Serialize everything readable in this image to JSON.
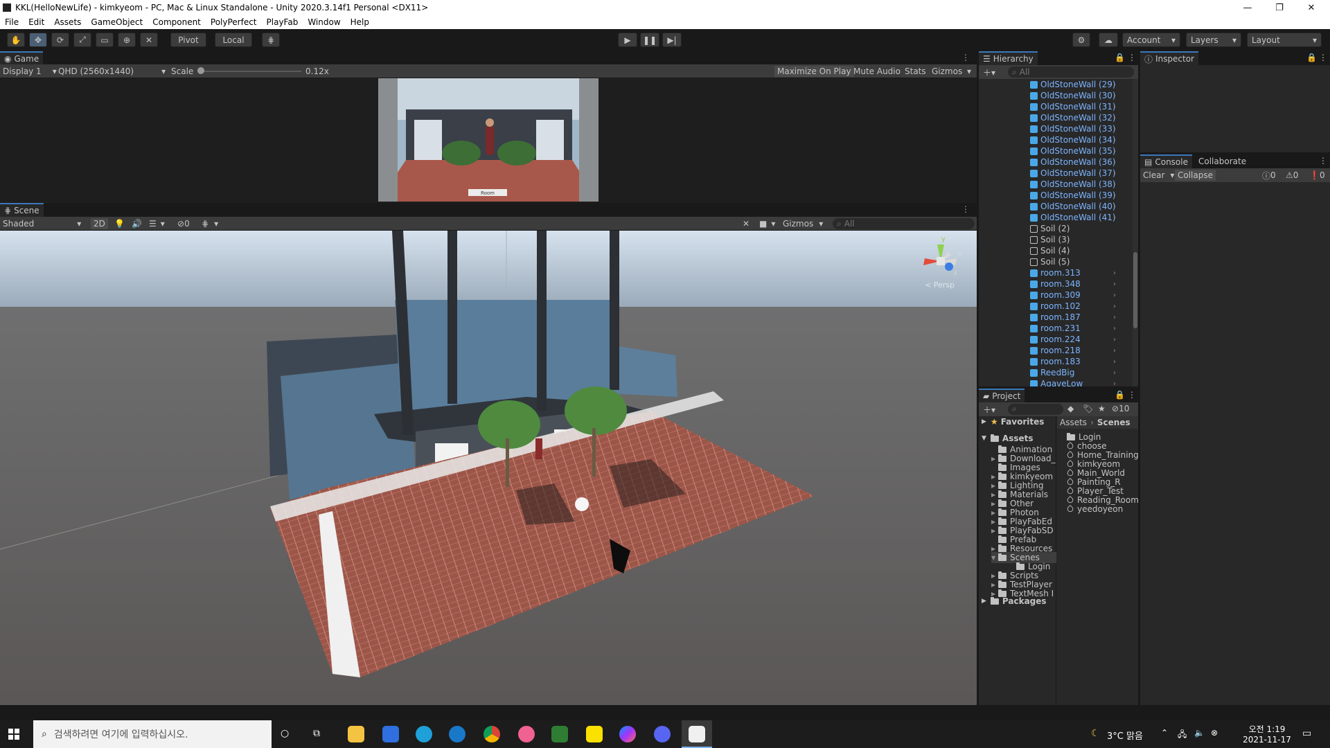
{
  "window": {
    "title": "KKL(HelloNewLife) - kimkyeom - PC, Mac & Linux Standalone - Unity 2020.3.14f1 Personal <DX11>",
    "controls": {
      "minimize": "—",
      "maximize": "❐",
      "close": "✕"
    }
  },
  "menu": [
    "File",
    "Edit",
    "Assets",
    "GameObject",
    "Component",
    "PolyPerfect",
    "PlayFab",
    "Window",
    "Help"
  ],
  "toolbar": {
    "pivot": "Pivot",
    "local": "Local",
    "account": "Account",
    "layers": "Layers",
    "layout": "Layout"
  },
  "game": {
    "tab": "Game",
    "display": "Display 1",
    "resolution": "QHD (2560x1440)",
    "scale_label": "Scale",
    "scale_value": "0.12x",
    "maximize": "Maximize On Play",
    "mute": "Mute Audio",
    "stats": "Stats",
    "gizmos": "Gizmos",
    "button_text": "Room"
  },
  "scene": {
    "tab": "Scene",
    "shading": "Shaded",
    "mode2d": "2D",
    "hidden_count": "0",
    "gizmos": "Gizmos",
    "search_placeholder": "All",
    "persp": "< Persp",
    "axis_y": "y",
    "axis_x": "x",
    "axis_z": "z"
  },
  "hierarchy": {
    "tab": "Hierarchy",
    "search_placeholder": "All",
    "items": [
      {
        "name": "OldStoneWall (29)",
        "prefab": true
      },
      {
        "name": "OldStoneWall (30)",
        "prefab": true
      },
      {
        "name": "OldStoneWall (31)",
        "prefab": true
      },
      {
        "name": "OldStoneWall (32)",
        "prefab": true
      },
      {
        "name": "OldStoneWall (33)",
        "prefab": true
      },
      {
        "name": "OldStoneWall (34)",
        "prefab": true
      },
      {
        "name": "OldStoneWall (35)",
        "prefab": true
      },
      {
        "name": "OldStoneWall (36)",
        "prefab": true
      },
      {
        "name": "OldStoneWall (37)",
        "prefab": true
      },
      {
        "name": "OldStoneWall (38)",
        "prefab": true
      },
      {
        "name": "OldStoneWall (39)",
        "prefab": true
      },
      {
        "name": "OldStoneWall (40)",
        "prefab": true
      },
      {
        "name": "OldStoneWall (41)",
        "prefab": true
      },
      {
        "name": "Soil (2)",
        "prefab": false
      },
      {
        "name": "Soil (3)",
        "prefab": false
      },
      {
        "name": "Soil (4)",
        "prefab": false
      },
      {
        "name": "Soil (5)",
        "prefab": false
      },
      {
        "name": "room.313",
        "prefab": true
      },
      {
        "name": "room.348",
        "prefab": true
      },
      {
        "name": "room.309",
        "prefab": true
      },
      {
        "name": "room.102",
        "prefab": true
      },
      {
        "name": "room.187",
        "prefab": true
      },
      {
        "name": "room.231",
        "prefab": true
      },
      {
        "name": "room.224",
        "prefab": true
      },
      {
        "name": "room.218",
        "prefab": true
      },
      {
        "name": "room.183",
        "prefab": true
      },
      {
        "name": "ReedBig",
        "prefab": true
      },
      {
        "name": "AgaveLow",
        "prefab": true
      }
    ]
  },
  "inspector": {
    "tab": "Inspector"
  },
  "console": {
    "tab": "Console",
    "tab2": "Collaborate",
    "clear": "Clear",
    "collapse": "Collapse",
    "info": "0",
    "warn": "0",
    "err": "0"
  },
  "project": {
    "tab": "Project",
    "hidden_count": "10",
    "favorites": "Favorites",
    "assets": "Assets",
    "packages": "Packages",
    "tree": [
      "Animation",
      "Download_",
      "Images",
      "kimkyeom",
      "Lighting",
      "Materials",
      "Other",
      "Photon",
      "PlayFabEd",
      "PlayFabSD",
      "Prefab",
      "Resources",
      "Scenes",
      "Login",
      "Scripts",
      "TestPlayer",
      "TextMesh I"
    ],
    "breadcrumb": [
      "Assets",
      "Scenes"
    ],
    "files": [
      {
        "name": "Login",
        "type": "folder"
      },
      {
        "name": "choose",
        "type": "scene"
      },
      {
        "name": "Home_Training",
        "type": "scene"
      },
      {
        "name": "kimkyeom",
        "type": "scene"
      },
      {
        "name": "Main_World",
        "type": "scene"
      },
      {
        "name": "Painting_R",
        "type": "scene"
      },
      {
        "name": "Player_Test",
        "type": "scene"
      },
      {
        "name": "Reading_Room",
        "type": "scene"
      },
      {
        "name": "yeedoyeon",
        "type": "scene"
      }
    ]
  },
  "taskbar": {
    "search_placeholder": "검색하려면 여기에 입력하십시오.",
    "weather": "3°C 맑음",
    "time": "오전 1:19",
    "date": "2021-11-17",
    "apps": [
      "file-explorer",
      "todo",
      "edge",
      "ie",
      "chrome",
      "app-pink",
      "app-yellow",
      "kakaotalk",
      "messenger",
      "discord",
      "unity"
    ]
  },
  "colors": {
    "accent": "#3a79bb",
    "prefab_text": "#7cb4ff",
    "panel": "#282828",
    "bg": "#191919"
  }
}
